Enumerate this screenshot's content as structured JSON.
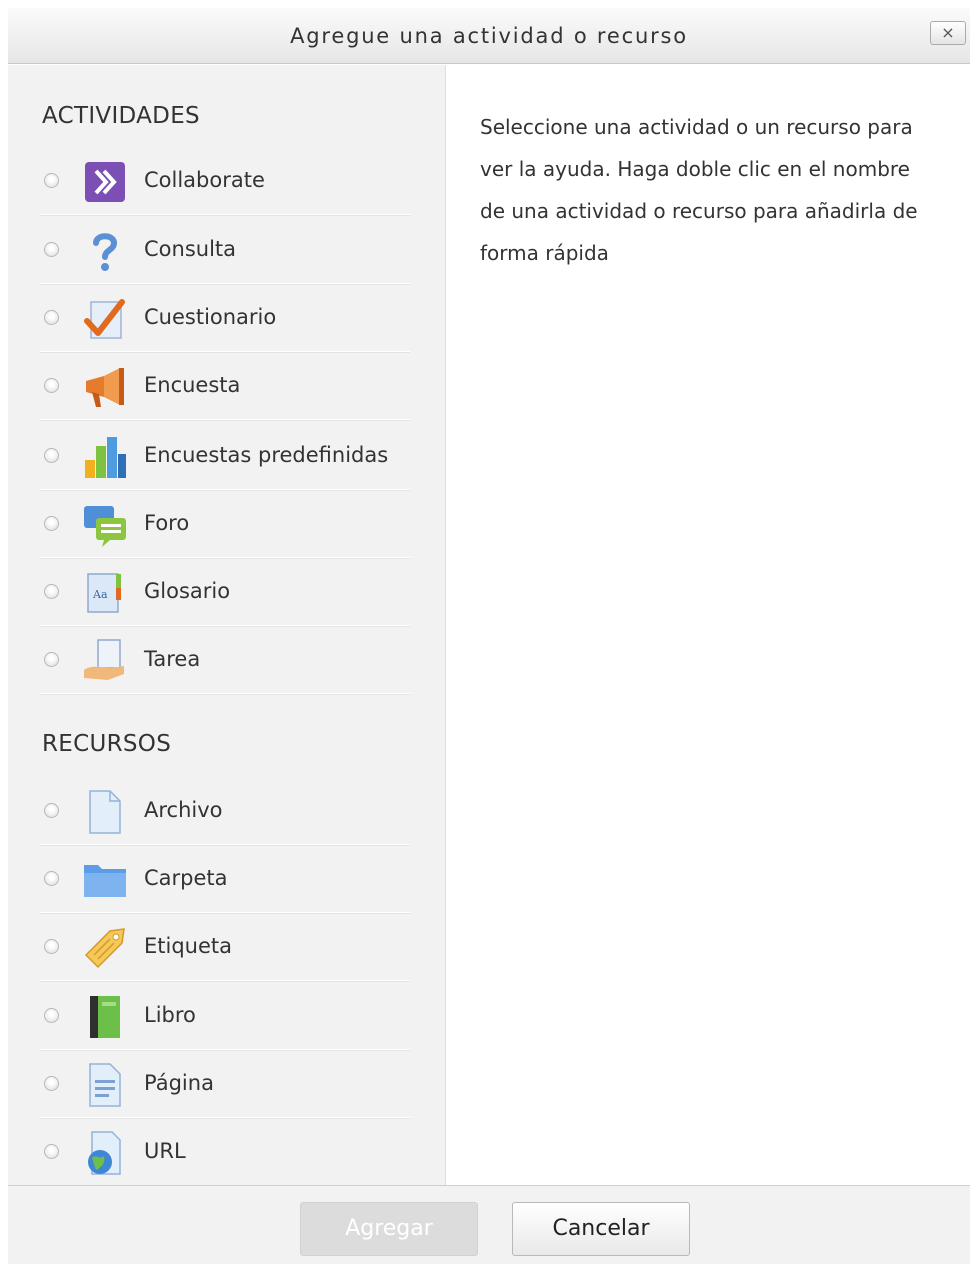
{
  "dialog": {
    "title": "Agregue una actividad o recurso",
    "close_label": "×"
  },
  "activities": {
    "heading": "ACTIVIDADES",
    "items": [
      {
        "label": "Collaborate",
        "icon": "collaborate-icon"
      },
      {
        "label": "Consulta",
        "icon": "question-mark-icon"
      },
      {
        "label": "Cuestionario",
        "icon": "quiz-checkmark-icon"
      },
      {
        "label": "Encuesta",
        "icon": "megaphone-icon"
      },
      {
        "label": "Encuestas predefinidas",
        "icon": "bar-chart-icon"
      },
      {
        "label": "Foro",
        "icon": "forum-bubbles-icon"
      },
      {
        "label": "Glosario",
        "icon": "glossary-book-icon"
      },
      {
        "label": "Tarea",
        "icon": "assignment-hand-icon"
      }
    ]
  },
  "resources": {
    "heading": "RECURSOS",
    "items": [
      {
        "label": "Archivo",
        "icon": "file-icon"
      },
      {
        "label": "Carpeta",
        "icon": "folder-icon"
      },
      {
        "label": "Etiqueta",
        "icon": "label-tag-icon"
      },
      {
        "label": "Libro",
        "icon": "book-icon"
      },
      {
        "label": "Página",
        "icon": "page-icon"
      },
      {
        "label": "URL",
        "icon": "url-globe-icon"
      }
    ]
  },
  "help": {
    "text": "Seleccione una actividad o un recurso para ver la ayuda. Haga doble clic en el nombre de una actividad o recurso para añadirla de forma rápida"
  },
  "footer": {
    "add_label": "Agregar",
    "cancel_label": "Cancelar"
  }
}
